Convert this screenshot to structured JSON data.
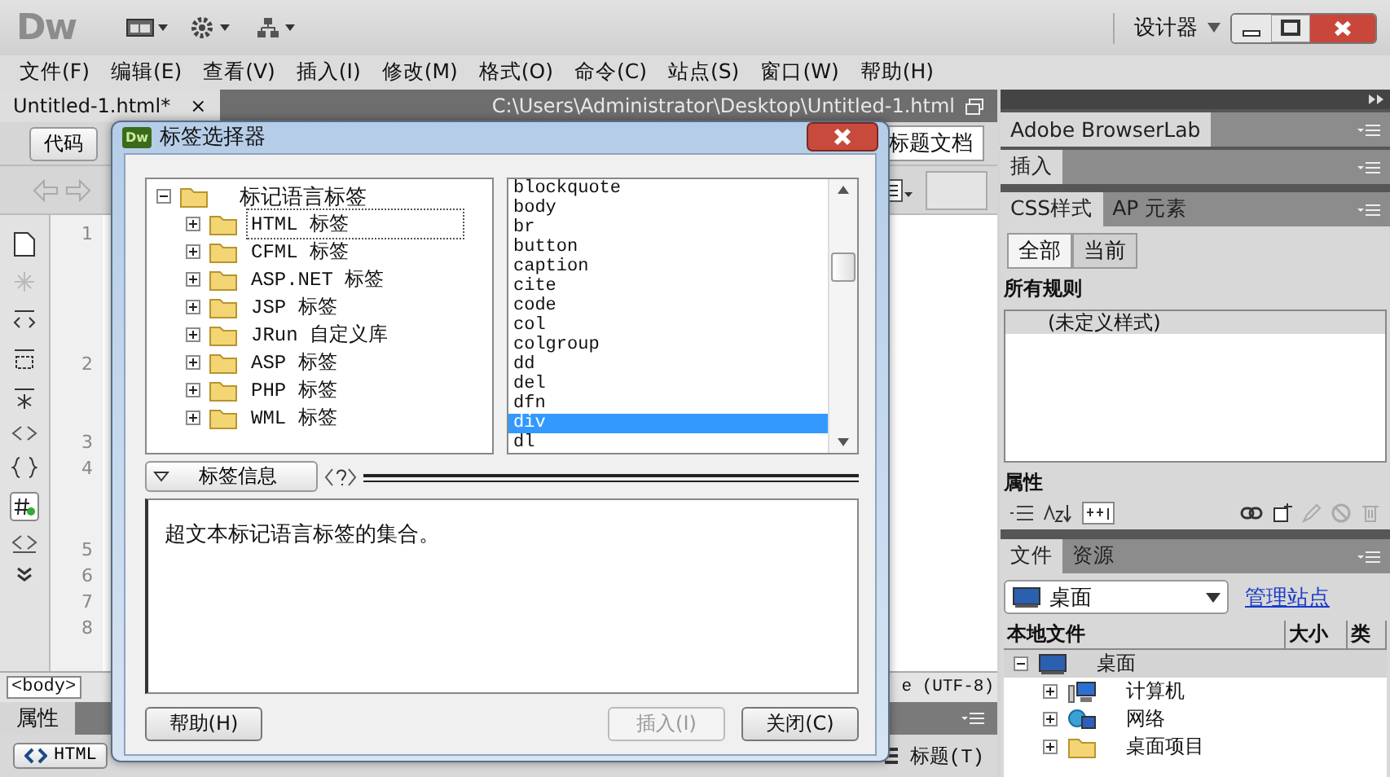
{
  "app": {
    "logo": "Dw",
    "workspace": "设计器"
  },
  "menu": [
    "文件(F)",
    "编辑(E)",
    "查看(V)",
    "插入(I)",
    "修改(M)",
    "格式(O)",
    "命令(C)",
    "站点(S)",
    "窗口(W)",
    "帮助(H)"
  ],
  "document": {
    "tab": {
      "label": "Untitled-1.html*",
      "close": "×"
    },
    "path": "C:\\Users\\Administrator\\Desktop\\Untitled-1.html",
    "code_button": "代码",
    "title_field": "标题文档",
    "line_numbers": [
      "1",
      "2",
      "3",
      "4",
      "5",
      "6",
      "7",
      "8"
    ],
    "tag_selector": "<body>",
    "encoding": "e (UTF-8)"
  },
  "properties": {
    "tab": "属性",
    "html_button": "HTML",
    "heading_label": "标题(T)"
  },
  "dialog": {
    "logo": "Dw",
    "title": "标签选择器",
    "tree": {
      "label": "标记语言标签",
      "expanded": true,
      "children": [
        {
          "label": "HTML 标签",
          "expanded": false,
          "focused": true
        },
        {
          "label": "CFML 标签",
          "expanded": false,
          "focused": false
        },
        {
          "label": "ASP.NET 标签",
          "expanded": false,
          "focused": false
        },
        {
          "label": "JSP 标签",
          "expanded": false,
          "focused": false
        },
        {
          "label": "JRun 自定义库",
          "expanded": false,
          "focused": false
        },
        {
          "label": "ASP 标签",
          "expanded": false,
          "focused": false
        },
        {
          "label": "PHP 标签",
          "expanded": false,
          "focused": false
        },
        {
          "label": "WML 标签",
          "expanded": false,
          "focused": false
        }
      ]
    },
    "tags": [
      {
        "label": "blockquote",
        "selected": false
      },
      {
        "label": "body",
        "selected": false
      },
      {
        "label": "br",
        "selected": false
      },
      {
        "label": "button",
        "selected": false
      },
      {
        "label": "caption",
        "selected": false
      },
      {
        "label": "cite",
        "selected": false
      },
      {
        "label": "code",
        "selected": false
      },
      {
        "label": "col",
        "selected": false
      },
      {
        "label": "colgroup",
        "selected": false
      },
      {
        "label": "dd",
        "selected": false
      },
      {
        "label": "del",
        "selected": false
      },
      {
        "label": "dfn",
        "selected": false
      },
      {
        "label": "div",
        "selected": true
      },
      {
        "label": "dl",
        "selected": false
      }
    ],
    "info_label": "标签信息",
    "info_expanded": true,
    "info_text": "超文本标记语言标签的集合。",
    "buttons": [
      {
        "label": "帮助(H)",
        "disabled": false
      },
      {
        "label": "插入(I)",
        "disabled": true
      },
      {
        "label": "关闭(C)",
        "disabled": false
      }
    ]
  },
  "panels": {
    "browserlab": "Adobe BrowserLab",
    "insert": "插入",
    "css": {
      "tabs": [
        {
          "label": "CSS样式",
          "selected": true
        },
        {
          "label": "AP 元素",
          "selected": false
        }
      ],
      "modes": [
        {
          "label": "全部",
          "selected": true
        },
        {
          "label": "当前",
          "selected": false
        }
      ],
      "rules_heading": "所有规则",
      "rules": [
        {
          "label": "(未定义样式)",
          "selected": true
        }
      ],
      "properties_heading": "属性"
    },
    "files": {
      "tabs": [
        {
          "label": "文件",
          "selected": true
        },
        {
          "label": "资源",
          "selected": false
        }
      ],
      "site": "桌面",
      "manage_link": "管理站点",
      "columns": [
        "本地文件",
        "大小",
        "类"
      ],
      "tree": {
        "label": "桌面",
        "kind": "desktop",
        "expanded": true,
        "selected": true,
        "children": [
          {
            "label": "计算机",
            "kind": "computer",
            "expanded": false,
            "selected": false
          },
          {
            "label": "网络",
            "kind": "network",
            "expanded": false,
            "selected": false
          },
          {
            "label": "桌面项目",
            "kind": "folder",
            "expanded": false,
            "selected": false
          }
        ]
      }
    }
  }
}
